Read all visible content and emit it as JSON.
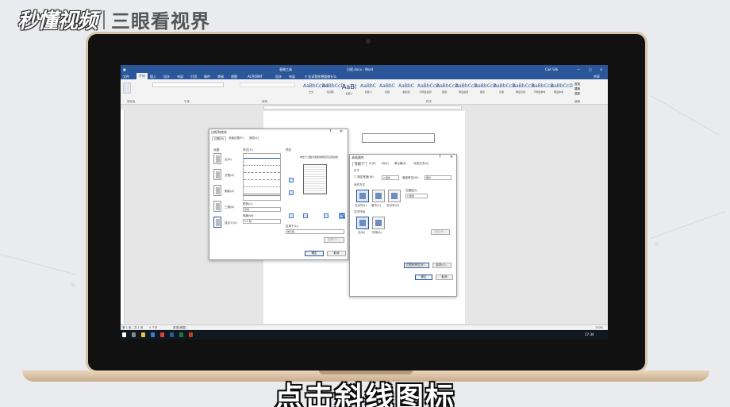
{
  "logo": {
    "brand": "秒懂视频",
    "subtitle": "三眼看视界"
  },
  "caption": "点击斜线图标",
  "word": {
    "context_tab": "表格工具",
    "doc_title": "日程.docx - Word",
    "menu": [
      "文件",
      "开始",
      "插入",
      "设计",
      "布局",
      "引用",
      "邮件",
      "审阅",
      "视图",
      "ACROBAT",
      "设计",
      "布局"
    ],
    "tell_me": "告诉我你想要做什么",
    "user": "Cait Silk",
    "share": "共享",
    "ribbon_groups": [
      "剪贴板",
      "字体",
      "段落",
      "样式",
      "编辑"
    ],
    "styles": [
      {
        "sample": "AaBbCcDd",
        "name": "正文"
      },
      {
        "sample": "AaBbCcD",
        "name": "无间隔"
      },
      {
        "sample": "AaBl",
        "name": "标题 1"
      },
      {
        "sample": "AaBbC",
        "name": "标题 2"
      },
      {
        "sample": "AaBbC",
        "name": "标题"
      },
      {
        "sample": "AaBbC",
        "name": "副标题"
      },
      {
        "sample": "AaBbCcD",
        "name": "不明显强调"
      },
      {
        "sample": "AaBbCcD",
        "name": "强调"
      },
      {
        "sample": "AaBbCcD",
        "name": "明显强调"
      },
      {
        "sample": "AaBbCcD",
        "name": "要点"
      },
      {
        "sample": "AaBbCcD",
        "name": "引用"
      },
      {
        "sample": "AaBbCcD",
        "name": "明显引用"
      },
      {
        "sample": "AaBbCcD",
        "name": "不明显参考"
      },
      {
        "sample": "AaBbCcD",
        "name": "明显参考"
      }
    ],
    "editing": [
      "查找",
      "替换",
      "选择"
    ],
    "status": {
      "page": "第 1 页，共 1 页",
      "words": "0 个字",
      "lang": "英语(美国)",
      "zoom": "110%"
    },
    "taskbar_time": "17:34"
  },
  "borders_dialog": {
    "title": "边框和底纹",
    "tabs": [
      "边框(B)",
      "页面边框(P)",
      "底纹(S)"
    ],
    "setting_label": "设置:",
    "settings": [
      "无(N)",
      "方框(X)",
      "阴影(A)",
      "三维(D)",
      "自定义(U)"
    ],
    "style_label": "样式(Y):",
    "color_label": "颜色(C):",
    "color_value": "自动",
    "width_label": "宽度(W):",
    "width_value": "0.5 磅",
    "preview_label": "预览",
    "preview_hint": "单击下方图示或使用按钮可应用边框",
    "apply_label": "应用于(L):",
    "apply_value": "单元格",
    "options_button": "选项(O)...",
    "ok": "确定",
    "cancel": "取消"
  },
  "table_props_dialog": {
    "title": "表格属性",
    "tabs": [
      "表格(T)",
      "行(R)",
      "列(U)",
      "单元格(E)",
      "可选文字(A)"
    ],
    "size_label": "尺寸",
    "pref_width": "指定宽度(W):",
    "pref_width_value": "0 厘米",
    "measure_label": "度量单位(M):",
    "measure_value": "厘米",
    "align_label": "对齐方式",
    "indent_label": "左缩进(I):",
    "indent_value": "0 厘米",
    "aligns": [
      "左对齐(L)",
      "居中(C)",
      "右对齐(H)"
    ],
    "wrap_label": "文字环绕",
    "wraps": [
      "无(N)",
      "环绕(A)"
    ],
    "position_button": "定位(P)...",
    "borders_button": "边框和底纹(B)...",
    "options_button": "选项(O)...",
    "ok": "确定",
    "cancel": "取消"
  }
}
